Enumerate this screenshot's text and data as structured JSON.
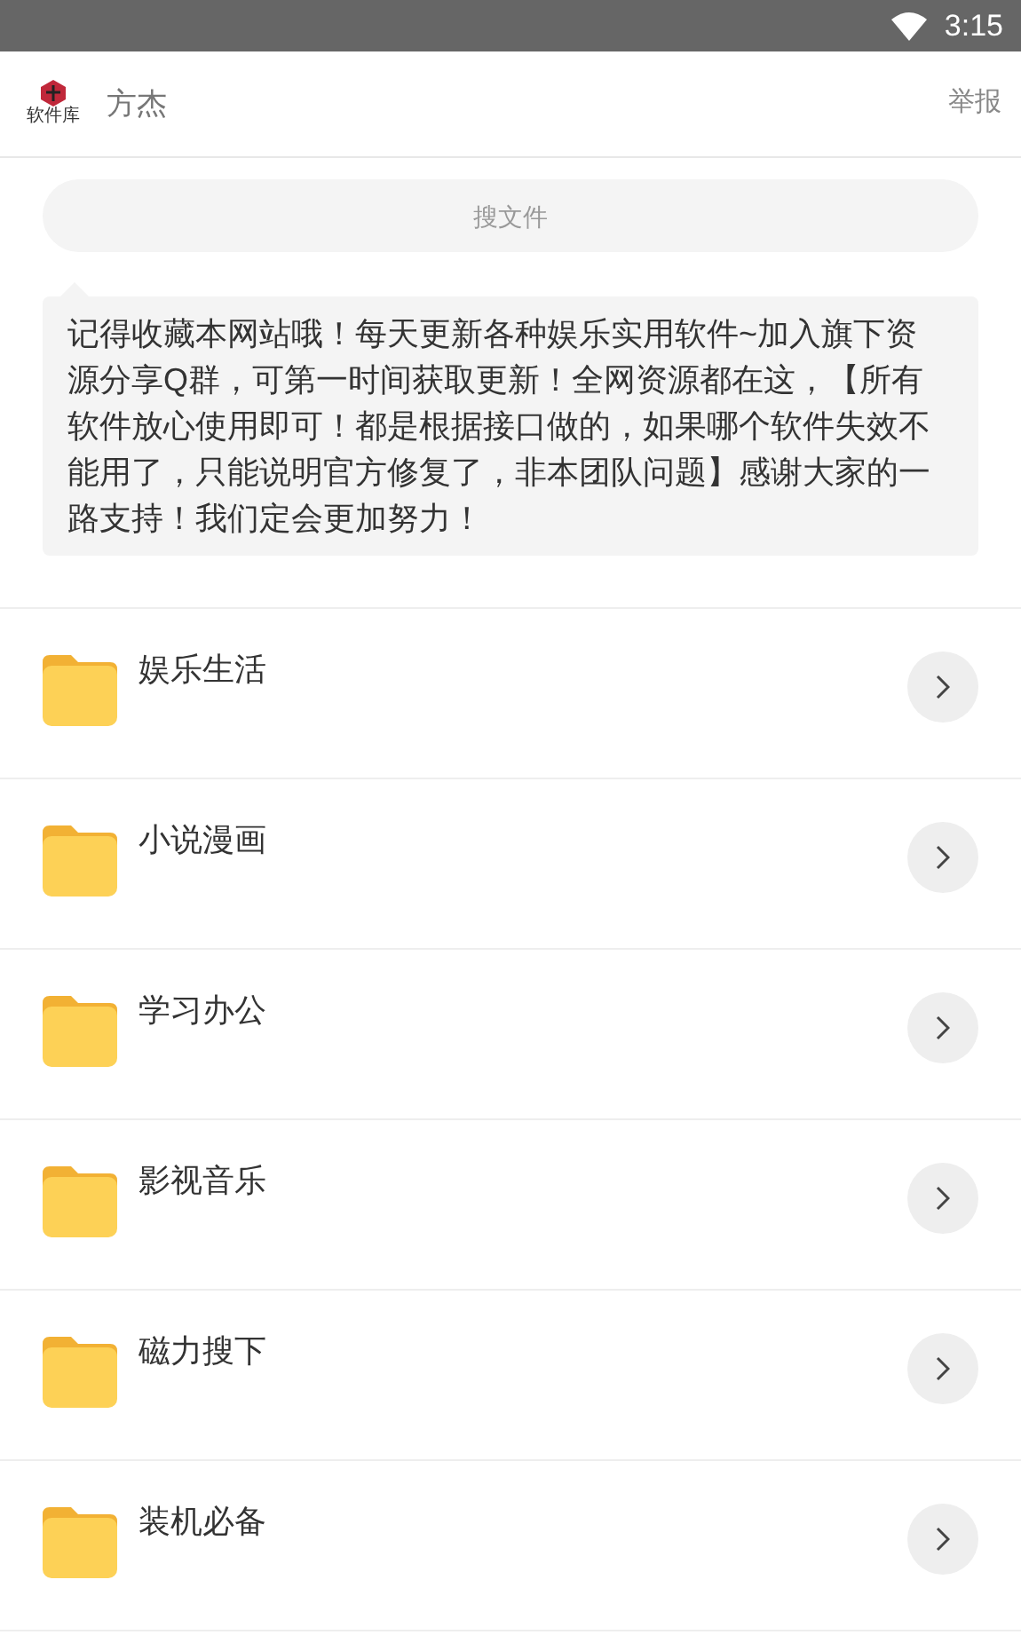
{
  "status_bar": {
    "time": "3:15"
  },
  "header": {
    "logo_text": "软件库",
    "title": "方杰",
    "report": "举报"
  },
  "search": {
    "placeholder": "搜文件"
  },
  "notice": "记得收藏本网站哦！每天更新各种娱乐实用软件~加入旗下资源分享Q群，可第一时间获取更新！全网资源都在这，【所有软件放心使用即可！都是根据接口做的，如果哪个软件失效不能用了，只能说明官方修复了，非本团队问题】感谢大家的一路支持！我们定会更加努力！",
  "folders": [
    {
      "name": "娱乐生活"
    },
    {
      "name": "小说漫画"
    },
    {
      "name": "学习办公"
    },
    {
      "name": "影视音乐"
    },
    {
      "name": "磁力搜下"
    },
    {
      "name": "装机必备"
    }
  ]
}
